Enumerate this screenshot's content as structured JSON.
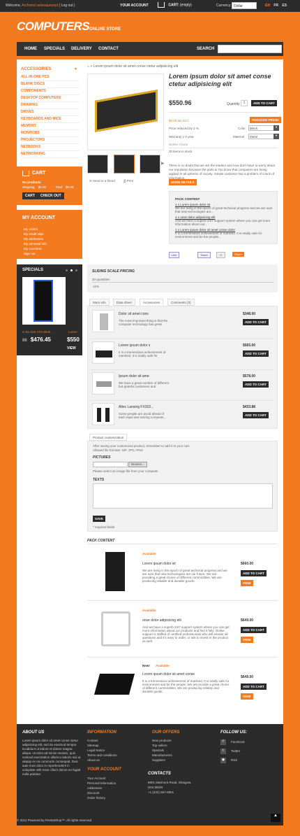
{
  "topbar": {
    "welcome": "Welcome,",
    "welcome_link": "Archived seriesquezept",
    "welcome_logout": "( Log out )",
    "your_account": "YOUR ACCOUNT",
    "cart_label": "CART:",
    "cart_value": "(empty)",
    "currency_label": "Currency:",
    "currency_value": "Dollar",
    "languages": [
      "EN",
      "FR",
      "ES"
    ]
  },
  "logo": {
    "main": "COMPUTERS",
    "sub": "ONLINE STORE"
  },
  "nav": {
    "items": [
      "HOME",
      "SPECIALS",
      "DELIVERY",
      "CONTACT"
    ],
    "search_label": "SEARCH"
  },
  "categories": {
    "title": "ACCESSORIES",
    "items": [
      "ALL-IN-ONE PCS",
      "BLANK DISCS",
      "COMPONENTS",
      "DESKTOP COMPUTERS",
      "DRAWING",
      "DRIVES",
      "KEYBOARDS AND MICE",
      "MEMORY",
      "MONITORS",
      "PROJECTORS",
      "NETBOOKS",
      "NETWORKING"
    ]
  },
  "cart_box": {
    "title": "CART",
    "no_products": "No products",
    "shipping_label": "Shipping",
    "shipping_value": "$0.00",
    "total_label": "Total",
    "total_value": "$0.00",
    "cart_btn": "CART",
    "checkout_btn": "CHECK OUT"
  },
  "account_box": {
    "title": "MY ACCOUNT",
    "items": [
      "My orders",
      "My credit slips",
      "My addresses",
      "My personal info",
      "My vouchers",
      "Sign out"
    ]
  },
  "specials_box": {
    "title": "SPECIALS",
    "product": "ei BLADE ATX-9840",
    "product_right": "Lorem",
    "old_price": "86",
    "price": "$476.45",
    "price_right": "$550",
    "view": "VIEW"
  },
  "breadcrumb": "Lorem ipsum dolor sit amet conse ctetur adipisicing elit",
  "product": {
    "title": "Lorem ipsum dolor sit amet conse ctetur adipisicing elit",
    "price": "$550.96",
    "quantity_label": "Quantity",
    "quantity": "1",
    "add_to_cart": "ADD TO CART",
    "tax": "$0.00 tax excl.",
    "reduced": "REDUCED PRICE!",
    "price_reduced": "Price reduced by 2 %",
    "color_label": "Color",
    "color_value": "Black",
    "warranty": "Warranty",
    "warranty_val": "1-2 year",
    "material_label": "Material",
    "material_value": "Metal",
    "delete": "Delete choice",
    "in_stock": "30 items in stock",
    "send": "Send to a friend",
    "print": "Print",
    "desc": "There is no doubt that we are the leaders and now don't have to worry about our reputation because the parts & You know that computers are being applied in all spheres of society. Simple customer has a problem of a lack of information.",
    "more": "MORE DETAILS"
  },
  "pack": {
    "title": "PACK CONTENT",
    "items": [
      {
        "name": "1 x Lorem ipsum dolor sit",
        "desc": "We are living in the epoch of great technical progress and we are sure that new technologies are..."
      },
      {
        "name": "1 x onse dolor adipisicing elit",
        "desc": "And we have a superb 24/7 support system where you can get more information about our..."
      },
      {
        "name": "1 x Lorem ipsum dolor sit amet conse dolor",
        "desc": "It is a tremendous achievement of mankind. It is totally safe for environment and be the people..."
      }
    ]
  },
  "social": {
    "like": "Like",
    "tweet": "Tweet",
    "plus": "+1",
    "share": "Share"
  },
  "sliding": {
    "title": "SLIDING SCALE PRICING",
    "qty": "30 quantities",
    "discount": "-11%"
  },
  "tabs": [
    "More info",
    "Data sheet",
    "Accessories",
    "Comments (3)"
  ],
  "accessories": [
    {
      "name": "Dolor sit amet cons",
      "desc": "The most important thing is that the computer technology has great",
      "price": "$348.00",
      "btn": "ADD TO CART"
    },
    {
      "name": "Lorem ipsum dolor s",
      "desc": "It is a tremendous achievement of mankind. It is totally safe for",
      "price": "$565.00",
      "btn": "ADD TO CART"
    },
    {
      "name": "Ipsum dolor sit ame",
      "desc": "We have a great number of different but grateful customers and",
      "price": "$578.00",
      "btn": "ADD TO CART"
    },
    {
      "name": "Altec Lansing FX302...",
      "desc": "Some people are avoid ahead of each input and solving computer...",
      "price": "$433.88",
      "btn": "ADD TO CART"
    }
  ],
  "customization": {
    "tab": "Product customization",
    "note": "After saving your customized product, remember to add it to your cart.",
    "allowed": "Allowed file formats: GIF, JPG, PNG",
    "pictures": "PICTURES",
    "browse": "Browse...",
    "upload": "Please select an image file from your computer",
    "texts": "TEXTS",
    "save": "SAVE",
    "required": "* required fields"
  },
  "pack_content": {
    "title": "PACK CONTENT",
    "items": [
      {
        "tag": "Available",
        "name": "Lorem ipsum dolor sit",
        "desc": "We are living in the epoch of great technical progress and we are sure that new technologies are our future. We are providing a great choice of different commodities. We are producing reliable and durable goods.",
        "price": "$660.00",
        "btn": "ADD TO CART",
        "view": "VIEW"
      },
      {
        "tag": "Available",
        "name": "onse dolor adipisicing elit",
        "desc": "And we have a superb 24/7 support system where you can get more information about our products and find it fully. Online support is staffed of certified professionals who will answer all questions and it's easy to order, or ask to invest in the product as well.",
        "price": "$649.00",
        "btn": "ADD TO CART",
        "view": "VIEW"
      },
      {
        "tag": "Available",
        "new": "New!",
        "name": "Lorem ipsum dolor sit amet conse",
        "desc": "It is a tremendous achievement of mankind. It is totally safe for environment and be the people. We are provide a great choice of different commodities. We are producing reliably and durable goods.",
        "price": "$649.00",
        "btn": "ADD TO CART",
        "view": "VIEW"
      }
    ]
  },
  "footer": {
    "about_title": "ABOUT US",
    "about_text": "Lorem ipsum dolor sit amet conse ctetur adipisicing elit, sed do eiusmod tempor incididunt ut labore et dolore magna aliqua. Ut enim ad minim veniam, quis nostrud exercitation ullamco laboris nisi ut aliquip ex ea commodo consequat. Duis aute irure dolor in reprehenderit in voluptate velit esse cillum dolore eu fugiat nulla pariatur.",
    "info_title": "INFORMATION",
    "info_items": [
      "Contact",
      "Sitemap",
      "Legal Notice",
      "Terms and conditions",
      "About us"
    ],
    "offers_title": "OUR OFFERS",
    "offers_items": [
      "New products",
      "Top sellers",
      "Specials",
      "Manufacturers",
      "Suppliers"
    ],
    "follow_title": "FOLLOW US:",
    "follow_items": [
      "Facebook",
      "Twitter",
      "RSS"
    ],
    "account_title": "YOUR ACCOUNT",
    "account_items": [
      "Your Account",
      "Personal information",
      "Addresses",
      "Discount",
      "Order history"
    ],
    "contacts_title": "CONTACTS",
    "contacts_items": [
      "8901 Marmora Road, Glasgow,",
      "D04 89GR",
      "+1 (234) 567-8901"
    ],
    "copyright": "© 2012 Powered by PrestaShop™. All rights reserved"
  }
}
